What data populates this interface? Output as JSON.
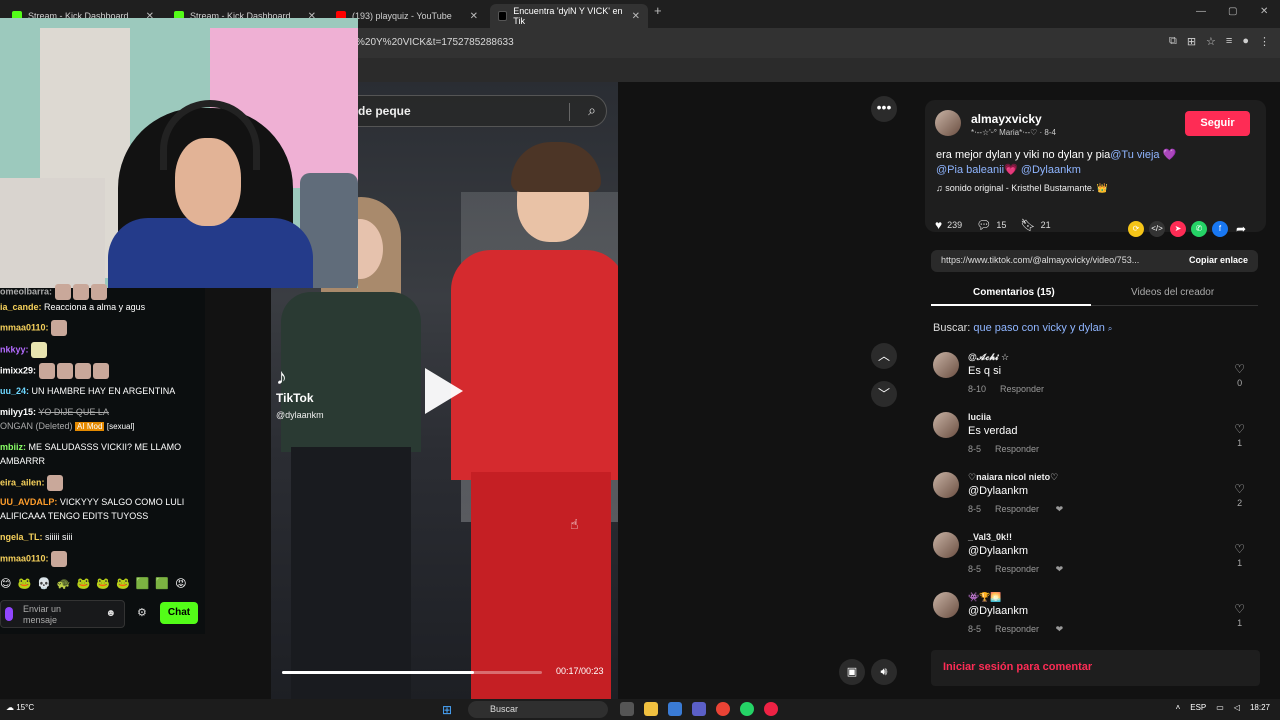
{
  "browser": {
    "tabs": [
      {
        "title": "Stream - Kick Dashboard",
        "color": "#53fc18"
      },
      {
        "title": "Stream - Kick Dashboard",
        "color": "#53fc18"
      },
      {
        "title": "(193) playquiz - YouTube",
        "color": "#ff0000"
      },
      {
        "title": "Encuentra 'dylN Y VICK' en Tik",
        "color": "#000000"
      }
    ],
    "new_tab": "+",
    "url": "%20Y%20VICK&t=1752785288633"
  },
  "video": {
    "search_query": "de peque",
    "tiktok_logo": "TikTok",
    "handle": "@dylaankm",
    "progress": 0.74,
    "time": "00:17/00:23"
  },
  "post": {
    "username": "almayxvicky",
    "subtitle": "*⋅--☆'ᵕ° Maria*⋅--♡ · 8-4",
    "follow_label": "Seguir",
    "description": "era mejor dylan y viki no dylan y pia",
    "mention1": "@Tu vieja",
    "mention2": "@Pia baleanii",
    "mention3": "@Dylaankm",
    "sound": "sonido original - Kristhel Bustamante.",
    "likes": "239",
    "comments": "15",
    "saves": "21",
    "link": "https://www.tiktok.com/@almayxvicky/video/753...",
    "copy_label": "Copiar enlace",
    "tab_comments": "Comentarios (15)",
    "tab_creator": "Videos del creador",
    "search_prefix": "Buscar:",
    "search_suggestion": "que paso con vicky y dylan",
    "login_label": "Iniciar sesión para comentar"
  },
  "comments": [
    {
      "name": "@𝓐𝓬𝓱𝓲 ☆",
      "text": "Es q si",
      "date": "8-10",
      "reply": "Responder",
      "likes": "0"
    },
    {
      "name": "luciia",
      "text": "Es verdad",
      "date": "8-5",
      "reply": "Responder",
      "likes": "1"
    },
    {
      "name": "♡naiara nicol nieto♡",
      "text": "@Dylaankm",
      "date": "8-5",
      "reply": "Responder",
      "likes": "2"
    },
    {
      "name": "_Val3_0k!!",
      "text": "@Dylaankm",
      "date": "8-5",
      "reply": "Responder",
      "likes": "1"
    },
    {
      "name": "👾🏆🌅",
      "text": "@Dylaankm",
      "date": "8-5",
      "reply": "Responder",
      "likes": "1"
    }
  ],
  "chat": {
    "messages": [
      {
        "user": "omeolbarra:",
        "text": "",
        "color": "#aaa"
      },
      {
        "user": "ia_cande:",
        "text": "Reacciona a alma y agus",
        "color": "#f5d05b"
      },
      {
        "user": "mmaa0110:",
        "text": "",
        "color": "#f5d05b"
      },
      {
        "user": "nkkyy:",
        "text": "",
        "color": "#b46bff"
      },
      {
        "user": "imixx29:",
        "text": "",
        "color": "#ffffff"
      },
      {
        "user": "uu_24:",
        "text": "UN HAMBRE HAY EN ARGENTINA",
        "color": "#6ed7ff"
      },
      {
        "user": "milyy15:",
        "text": "YO DIJE QUE LA",
        "color": "#ffffff"
      },
      {
        "user": "",
        "text": "ONGAN (Deleted)",
        "color": "#aaa"
      },
      {
        "user": "mbiiz:",
        "text": "ME SALUDASSS VICKII? ME LLAMO",
        "color": "#88ff66"
      },
      {
        "user": "",
        "text": "AMBARRR",
        "color": "#fff"
      },
      {
        "user": "eira_ailen:",
        "text": "",
        "color": "#f5d05b"
      },
      {
        "user": "UU_AVDALP:",
        "text": "VICKYYY SALGO COMO LULI",
        "color": "#ff9e2c"
      },
      {
        "user": "",
        "text": "ALIFICAAA TENGO EDITS TUYOSS",
        "color": "#fff"
      },
      {
        "user": "ngela_TL:",
        "text": "siiiii siii",
        "color": "#f5d05b"
      },
      {
        "user": "mmaa0110:",
        "text": "",
        "color": "#f5d05b"
      }
    ],
    "mod_badge": "AI Mod",
    "mod_reason": "[sexual]",
    "input_placeholder": "Enviar un mensaje",
    "send_label": "Chat"
  },
  "taskbar": {
    "temp": "15°C",
    "search": "Buscar",
    "lang": "ESP",
    "time": "18:27"
  }
}
